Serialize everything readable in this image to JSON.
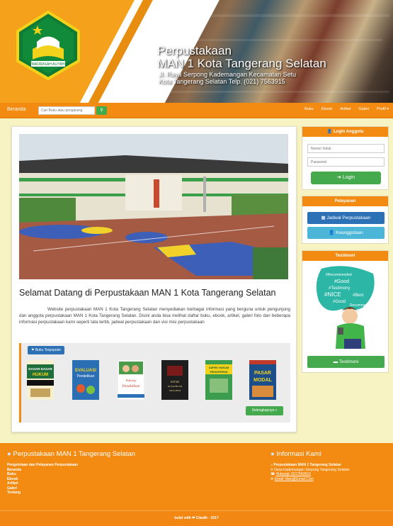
{
  "header": {
    "title_line1": "Perpustakaan",
    "title_line2": "MAN 1 Kota Tangerang Selatan",
    "address_line1": "Jl. Raya Serpong Kademangan Kecamatan Setu",
    "address_line2": "Kota Tangerang Selatan Telp. (021) 7563915",
    "logo_text": "MADRASAH ALIYAH"
  },
  "navbar": {
    "home": "Beranda",
    "search_placeholder": "Cari Buku atau pengarang",
    "links": [
      "Buku",
      "Ebook",
      "Artikel",
      "Galeri",
      "Profil ▾"
    ]
  },
  "main": {
    "welcome": "Selamat Datang di Perpustakaan MAN 1 Kota Tangerang Selatan",
    "paragraph": "Website perpustakaan MAN 1 Kota Tangerang Selatan menyediakan berbagai informasi yang berguna untuk pengunjung dan anggota perpustakaan MAN 1 Kota Tangerang Selatan. Disini anda bisa melihat daftar buku, ebook, artikel, galeri foto dan beberapa informasi perpustakaan kami seperti tata tertib, jadwal perpustakaan dan visi misi perpustakaan",
    "popular_label": "Buku Terpopuler",
    "more_button": "Selengkapnya »",
    "books": [
      {
        "title": "DASAR-DASAR HUKUM PERBURUHAN",
        "color": "#1f6d3a"
      },
      {
        "title": "EVALUASI Pendidikan",
        "color": "#2a6fb3"
      },
      {
        "title": "Psikologi Pendidikan",
        "color": "#ffffff"
      },
      {
        "title": "KITAB RIYADHUSH SHALIHIN",
        "color": "#222222"
      },
      {
        "title": "ASPEK HUKUM PENGOPERAN",
        "color": "#3b9d4d"
      },
      {
        "title": "PASAR MODAL",
        "color": "#1c4f8a"
      }
    ]
  },
  "login": {
    "title": "Login Anggota",
    "username_placeholder": "Nomor Induk",
    "password_placeholder": "Password",
    "button": "Login"
  },
  "services": {
    "title": "Pelayanan",
    "schedule": "Jadwal Perpustakaan",
    "membership": "Keanggotaan"
  },
  "testimonial": {
    "title": "Testimoni",
    "button": "Testimoni",
    "bubble_words": [
      "#Recommended",
      "#Good",
      "#Testimony",
      "#NICE",
      "#Best",
      "#Good",
      "Recommended"
    ]
  },
  "footer": {
    "left_title": "Perpustakaan MAN 1 Tangerang Selatan",
    "left_links": [
      "Pengelolaan dan Pelayanan Perpustakaan",
      "Beranda",
      "Buku",
      "Ebook",
      "Artikel",
      "Galeri",
      "Tentang"
    ],
    "right_title": "Informasi Kami",
    "right_items": [
      "Perpustakaan MAN 1 Tangerang Selatan",
      "Desa Kademangan Serpong Tangerang Selatan",
      "Hubungi: 0217563915",
      "Email: Man@Gmail.Com"
    ],
    "copyright": "build with ❤ Ciladik - 2017"
  },
  "colors": {
    "orange": "#f38b13",
    "green": "#45a94d",
    "blue": "#2c71b6",
    "cyan": "#4cb6d8",
    "page_bg": "#f7f3c3"
  }
}
